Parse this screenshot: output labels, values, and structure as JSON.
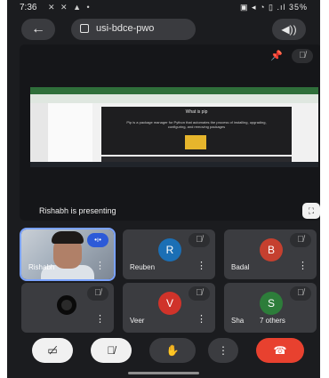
{
  "status_bar": {
    "time": "7:36",
    "notif_icons": "✕ ✕ ▲ •",
    "right_icons": "▣ ◂ ◔ ▯ .ıl",
    "battery": "35%"
  },
  "topbar": {
    "meeting_code": "usi-bdce-pwo",
    "back_icon": "arrow-left-icon",
    "speaker_icon": "speaker-icon"
  },
  "presentation": {
    "label": "Rishabh is presenting",
    "slide_title": "What is pip",
    "slide_text": "Pip is a package manager for Python that automates the process of installing, upgrading, configuring, and removing packages",
    "slide_image_label": "pip"
  },
  "participants": [
    {
      "name": "Rishabh",
      "initial": "",
      "color": "",
      "muted": false,
      "video": true
    },
    {
      "name": "Reuben",
      "initial": "R",
      "color": "#1b6fb5",
      "muted": true,
      "video": false
    },
    {
      "name": "Badal",
      "initial": "B",
      "color": "#c5402f",
      "muted": true,
      "video": false
    },
    {
      "name": "",
      "initial": "",
      "color": "",
      "muted": true,
      "video": false
    },
    {
      "name": "Veer",
      "initial": "V",
      "color": "#d0332a",
      "muted": true,
      "video": false
    },
    {
      "name": "Sha",
      "initial": "S",
      "color": "#2d7d3a",
      "muted": true,
      "video": false
    }
  ],
  "others_label": "7 others",
  "controls": {
    "camera_icon": "camera-off-icon",
    "mic_icon": "mic-off-icon",
    "hand_icon": "raise-hand-icon",
    "more_icon": "more-icon",
    "end_icon": "end-call-icon",
    "end_color": "#e8412f"
  }
}
